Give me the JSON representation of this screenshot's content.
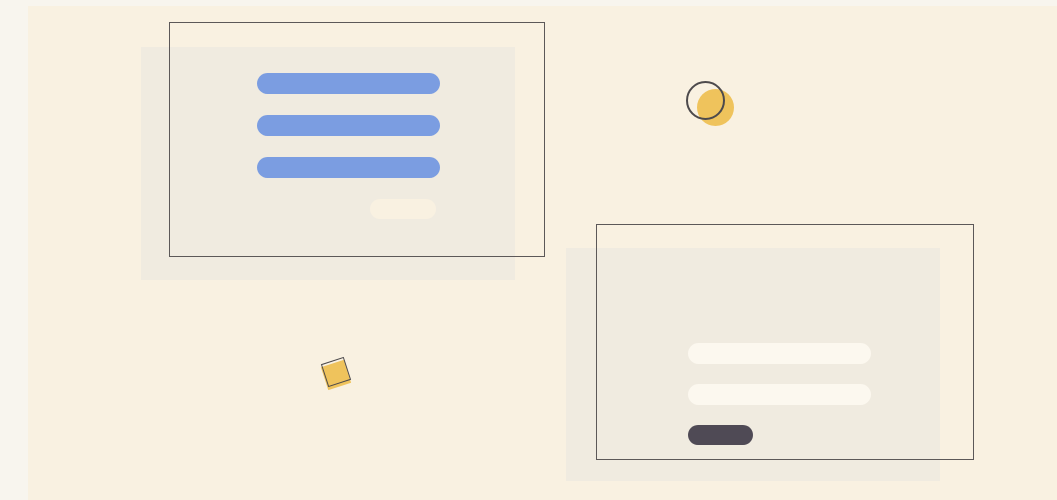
{
  "colors": {
    "page_background": "#f8f5ee",
    "scene_background": "#f9f1e1",
    "card_shadow": "#f0ebe0",
    "frame_outline": "#5c5858",
    "accent_blue": "#7b9de1",
    "light_bar": "#fcf8ef",
    "dark_button": "#4f4a55",
    "accent_yellow": "#efc35c"
  },
  "cards": [
    {
      "name": "top-left-card",
      "bars": 3,
      "bar_color": "accent_blue",
      "has_pill": true
    },
    {
      "name": "bottom-right-card",
      "bars": 2,
      "bar_color": "light_bar",
      "has_button": true
    }
  ],
  "decorations": [
    "circle-shape",
    "diamond-shape"
  ]
}
